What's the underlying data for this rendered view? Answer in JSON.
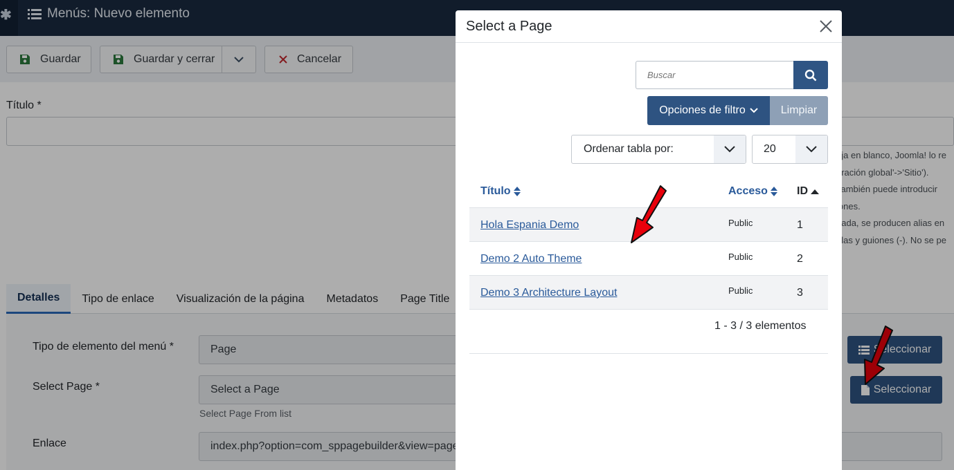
{
  "header": {
    "title": "Menús: Nuevo elemento"
  },
  "toolbar": {
    "save_label": "Guardar",
    "save_close_label": "Guardar y cerrar",
    "cancel_label": "Cancelar"
  },
  "form": {
    "title_label": "Título *",
    "help_lines": [
      "eja en blanco, Joomla! lo re",
      "uración global'->'Sitio').",
      "También puede introducir",
      "iones.",
      "nada, se producen alias en",
      "ulas y guiones (-). No se pe"
    ],
    "tabs": [
      "Detalles",
      "Tipo de enlace",
      "Visualización de la página",
      "Metadatos",
      "Page Title"
    ],
    "menu_type_label": "Tipo de elemento del menú *",
    "menu_type_value": "Page",
    "menu_type_button": "Seleccionar",
    "select_page_label": "Select Page *",
    "select_page_value": "Select a Page",
    "select_page_hint": "Select Page From list",
    "select_page_button": "Seleccionar",
    "link_label": "Enlace",
    "link_value": "index.php?option=com_sppagebuilder&view=page"
  },
  "modal": {
    "title": "Select a Page",
    "search_placeholder": "Buscar",
    "filter_button": "Opciones de filtro",
    "clear_button": "Limpiar",
    "order_label": "Ordenar tabla por:",
    "limit_value": "20",
    "columns": {
      "title": "Título",
      "access": "Acceso",
      "id": "ID"
    },
    "rows": [
      {
        "title": "Hola Espania Demo",
        "access": "Public",
        "id": "1"
      },
      {
        "title": "Demo 2 Auto Theme",
        "access": "Public",
        "id": "2"
      },
      {
        "title": "Demo 3 Architecture Layout",
        "access": "Public",
        "id": "3"
      }
    ],
    "pagination": "1 - 3 / 3 elementos"
  },
  "colors": {
    "primary": "#2e5381",
    "link": "#2a5a9a",
    "header_bg": "#1a2a40",
    "arrow": "#e8000b"
  }
}
